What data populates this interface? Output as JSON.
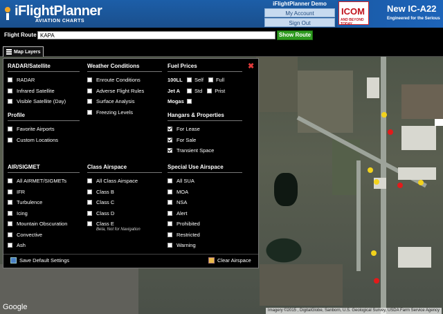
{
  "header": {
    "logo_name": "iFlightPlanner",
    "logo_sub": "AVIATION CHARTS",
    "user_name": "iFlightPlanner Demo",
    "my_account": "My Account",
    "sign_out": "Sign Out"
  },
  "ad": {
    "brand": "ICOM",
    "tag": "AND BEYOND TODAY",
    "title": "New IC-A22",
    "tagline": "Engineered for the Serious"
  },
  "route": {
    "label": "Flight Route",
    "value": "KAPA",
    "show_button": "Show Route"
  },
  "tabs": {
    "map_layers": "Map Layers"
  },
  "panel": {
    "close": "✖",
    "radar": {
      "title": "RADAR/Satellite",
      "items": [
        {
          "label": "RADAR",
          "checked": false
        },
        {
          "label": "Infrared Satellite",
          "checked": false
        },
        {
          "label": "Visible Satellite (Day)",
          "checked": false
        }
      ]
    },
    "profile": {
      "title": "Profile",
      "items": [
        {
          "label": "Favorite Airports",
          "checked": false
        },
        {
          "label": "Custom Locations",
          "checked": false
        }
      ]
    },
    "weather": {
      "title": "Weather Conditions",
      "items": [
        {
          "label": "Enroute Conditions",
          "checked": false
        },
        {
          "label": "Adverse Flight Rules",
          "checked": false
        },
        {
          "label": "Surface Analysis",
          "checked": false
        },
        {
          "label": "Freezing Levels",
          "checked": false
        }
      ]
    },
    "fuel": {
      "title": "Fuel Prices",
      "rows": [
        {
          "label": "100LL",
          "options": [
            {
              "label": "Self"
            },
            {
              "label": "Full"
            }
          ]
        },
        {
          "label": "Jet A",
          "options": [
            {
              "label": "Std"
            },
            {
              "label": "Prist"
            }
          ]
        },
        {
          "label": "Mogas",
          "options": [
            {
              "label": ""
            }
          ]
        }
      ]
    },
    "hangars": {
      "title": "Hangars & Properties",
      "items": [
        {
          "label": "For Lease",
          "checked": true
        },
        {
          "label": "For Sale",
          "checked": true
        },
        {
          "label": "Transient Space",
          "checked": true
        }
      ]
    },
    "airsigmet": {
      "title": "AIR/SIGMET",
      "items": [
        {
          "label": "All AIRMET/SIGMETs",
          "checked": false
        },
        {
          "label": "IFR",
          "checked": false
        },
        {
          "label": "Turbulence",
          "checked": false
        },
        {
          "label": "Icing",
          "checked": false
        },
        {
          "label": "Mountain Obscuration",
          "checked": false
        },
        {
          "label": "Convective",
          "checked": false
        },
        {
          "label": "Ash",
          "checked": false
        }
      ]
    },
    "class_airspace": {
      "title": "Class Airspace",
      "items": [
        {
          "label": "All Class Airspace",
          "checked": false
        },
        {
          "label": "Class B",
          "checked": false
        },
        {
          "label": "Class C",
          "checked": false
        },
        {
          "label": "Class D",
          "checked": false
        },
        {
          "label": "Class E",
          "checked": false
        }
      ],
      "note": "Beta, Not for Navigation"
    },
    "special_use": {
      "title": "Special Use Airspace",
      "items": [
        {
          "label": "All SUA",
          "checked": false
        },
        {
          "label": "MOA",
          "checked": false
        },
        {
          "label": "NSA",
          "checked": false
        },
        {
          "label": "Alert",
          "checked": false
        },
        {
          "label": "Prohibited",
          "checked": false
        },
        {
          "label": "Restricted",
          "checked": false
        },
        {
          "label": "Warning",
          "checked": false
        }
      ]
    },
    "footer": {
      "save_default": "Save Default Settings",
      "clear_airspace": "Clear Airspace"
    }
  },
  "map": {
    "google": "Google",
    "attribution": "Imagery ©2015 , DigitalGlobe, Sanborn, U.S. Geological Survey, USDA Farm Service Agency"
  }
}
